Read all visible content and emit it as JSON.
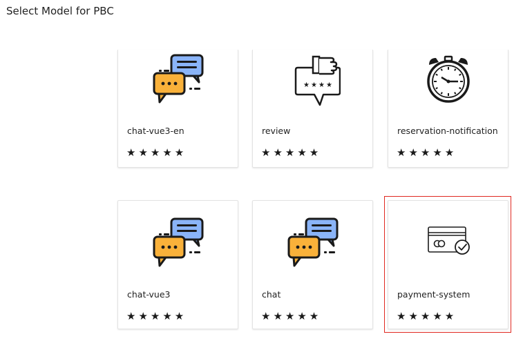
{
  "page": {
    "title": "Select Model for PBC"
  },
  "models": [
    {
      "name": "chat-vue3-en",
      "icon": "chat-bubbles-icon",
      "stars": "★★★★★"
    },
    {
      "name": "review",
      "icon": "review-thumbs-up-icon",
      "stars": "★★★★★"
    },
    {
      "name": "reservation-notification",
      "icon": "alarm-clock-icon",
      "stars": "★★★★★"
    },
    {
      "name": "chat-vue3",
      "icon": "chat-bubbles-icon",
      "stars": "★★★★★"
    },
    {
      "name": "chat",
      "icon": "chat-bubbles-icon",
      "stars": "★★★★★"
    },
    {
      "name": "payment-system",
      "icon": "credit-card-check-icon",
      "stars": "★★★★★"
    }
  ],
  "selected_model": "payment-system",
  "colors": {
    "chat_blue": "#8ab4f8",
    "chat_orange": "#f9b13a",
    "selection_red": "#e0271f"
  }
}
